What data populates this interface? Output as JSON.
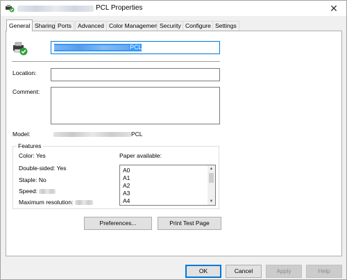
{
  "window": {
    "title_suffix": "PCL Properties",
    "close_glyph": "✕"
  },
  "tabs": [
    {
      "label": "General",
      "active": true
    },
    {
      "label": "Sharing"
    },
    {
      "label": "Ports"
    },
    {
      "label": "Advanced"
    },
    {
      "label": "Color Management"
    },
    {
      "label": "Security"
    },
    {
      "label": "Configure"
    },
    {
      "label": "Settings"
    }
  ],
  "general": {
    "printer_name_suffix": "PCL",
    "location_label": "Location:",
    "location_value": "",
    "comment_label": "Comment:",
    "comment_value": "",
    "model_label": "Model:",
    "model_suffix": "PCL"
  },
  "features": {
    "legend": "Features",
    "color": "Color: Yes",
    "double_sided": "Double-sided: Yes",
    "staple": "Staple: No",
    "speed_label": "Speed:",
    "max_res_label": "Maximum resolution:",
    "paper_label": "Paper available:",
    "paper_sizes": [
      "A0",
      "A1",
      "A2",
      "A3",
      "A4"
    ]
  },
  "buttons": {
    "preferences": "Preferences...",
    "print_test": "Print Test Page",
    "ok": "OK",
    "cancel": "Cancel",
    "apply": "Apply",
    "help": "Help"
  },
  "icons": {
    "title": "printer-check-icon",
    "printer": "printer-check-icon",
    "close": "close-icon"
  },
  "colors": {
    "accent": "#0078d7",
    "selection": "#3399ff",
    "check_green": "#2e9e3a"
  }
}
